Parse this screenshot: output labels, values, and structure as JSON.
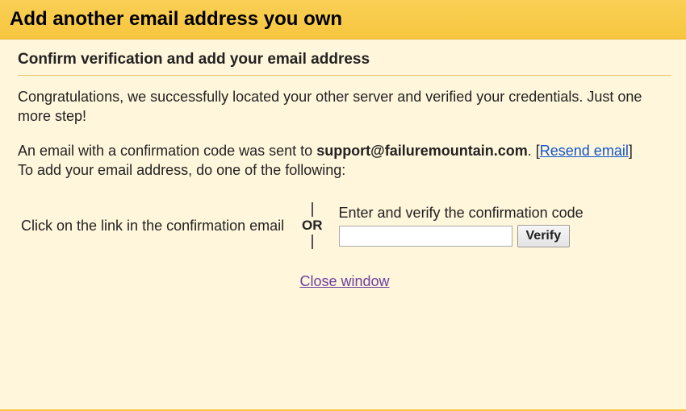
{
  "title": "Add another email address you own",
  "subheading": "Confirm verification and add your email address",
  "congrats_text": "Congratulations, we successfully located your other server and verified your credentials. Just one more step!",
  "sent_prefix": "An email with a confirmation code was sent to ",
  "sent_email": "support@failuremountain.com",
  "sent_suffix": ". [",
  "resend_label": "Resend email",
  "sent_close_bracket": "]",
  "instruction_line2": "To add your email address, do one of the following:",
  "option_left": "Click on the link in the confirmation email",
  "or_label": "OR",
  "option_right_label": "Enter and verify the confirmation code",
  "verify_button": "Verify",
  "code_value": "",
  "close_window": "Close window"
}
